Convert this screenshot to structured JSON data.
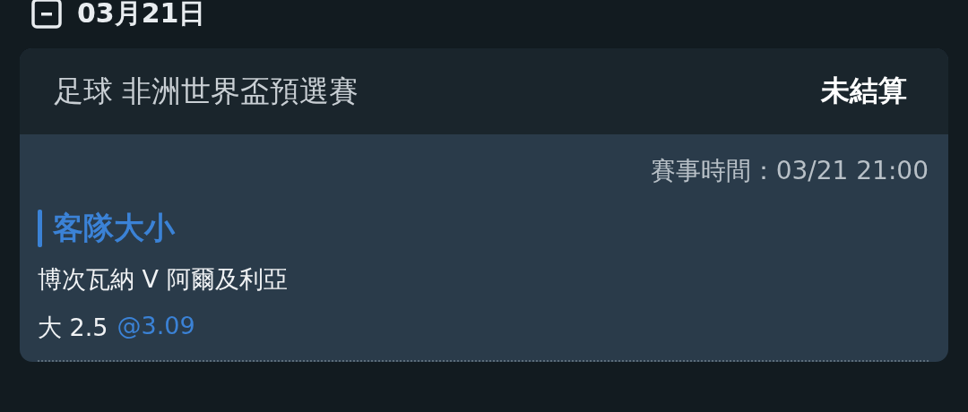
{
  "date_header": {
    "label": "03月21日"
  },
  "bet_card": {
    "sport": "足球",
    "league": "非洲世界盃預選賽",
    "status": "未結算",
    "match_time": "賽事時間：03/21 21:00",
    "market": "客隊大小",
    "teams": "博次瓦納 V 阿爾及利亞",
    "selection": "大 2.5",
    "odds": "@3.09"
  }
}
